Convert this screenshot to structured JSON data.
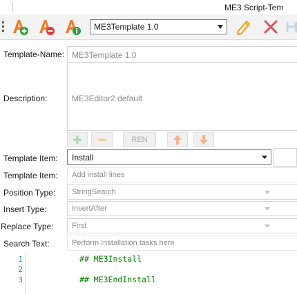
{
  "window": {
    "title": "ME3 Script-Tem"
  },
  "toolbar": {
    "template_select": {
      "value": "ME3Template 1.0"
    },
    "buttons": [
      {
        "name": "add-template",
        "icon": "a-plus-icon",
        "color": "#f07a2a"
      },
      {
        "name": "remove-template",
        "icon": "a-minus-icon",
        "color": "#f07a2a"
      },
      {
        "name": "template-info",
        "icon": "a-info-icon",
        "color": "#f07a2a"
      },
      {
        "name": "edit",
        "icon": "pencil-icon",
        "color": "#f5a623"
      },
      {
        "name": "delete",
        "icon": "x-icon",
        "color": "#e05050"
      },
      {
        "name": "save",
        "icon": "save-icon",
        "color": "#b8c4d0"
      }
    ]
  },
  "form": {
    "template_name": {
      "label": "Template-Name:",
      "value": "ME3Template 1.0"
    },
    "description": {
      "label": "Description:",
      "value": "ME3Editor2 default"
    },
    "item_buttons": {
      "add": "+",
      "remove": "−",
      "rename": "REN",
      "move_up": "↑",
      "move_down": "↓"
    },
    "template_item_select": {
      "label": "Template Item:",
      "value": "Install"
    },
    "template_item_text": {
      "label": "Template Item:",
      "placeholder": "Add install lines"
    },
    "position_type": {
      "label": "Position Type:",
      "value": "StringSearch"
    },
    "insert_type": {
      "label": "Insert Type:",
      "value": "InsertAfter"
    },
    "replace_type": {
      "label": "Replace Type:",
      "value": "First"
    },
    "search_text": {
      "label": "Search Text:",
      "placeholder": "Perform Installation tasks here"
    }
  },
  "editor": {
    "lines": [
      {
        "num": "1",
        "text": "## ME3Install"
      },
      {
        "num": "2",
        "text": ""
      },
      {
        "num": "3",
        "text": "## ME3EndInstall"
      }
    ]
  },
  "colors": {
    "accent": "#f07a2a",
    "code_text": "#008000",
    "line_number": "#2b91af"
  }
}
